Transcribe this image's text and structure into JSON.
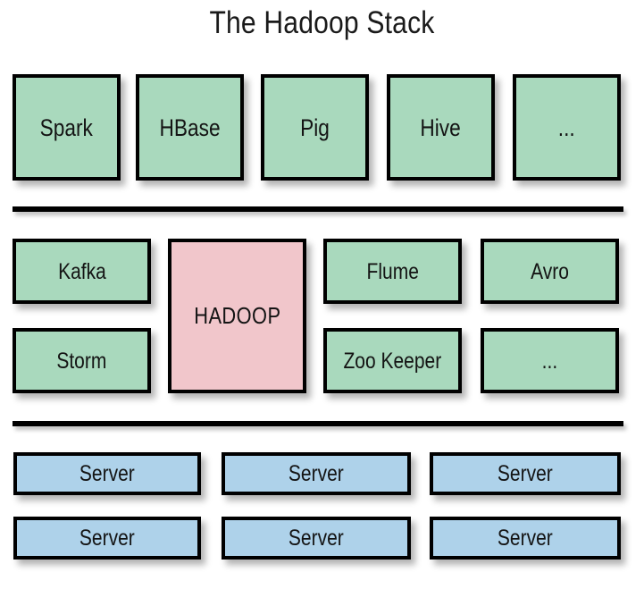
{
  "diagram": {
    "title": "The Hadoop Stack",
    "background_color": "#ffffff",
    "colors": {
      "tool_fill": "#a9d9bd",
      "core_fill": "#f1c6cb",
      "server_fill": "#aed2ea",
      "border": "#000000",
      "text": "#141414"
    },
    "layers": {
      "applications": {
        "boxes": [
          {
            "label": "Spark"
          },
          {
            "label": "HBase"
          },
          {
            "label": "Pig"
          },
          {
            "label": "Hive"
          },
          {
            "label": "..."
          }
        ]
      },
      "platform": {
        "core": {
          "label": "HADOOP"
        },
        "left_column": [
          {
            "label": "Kafka"
          },
          {
            "label": "Storm"
          }
        ],
        "middle_column": [
          {
            "label": "Flume"
          },
          {
            "label": "Zoo Keeper"
          }
        ],
        "right_column": [
          {
            "label": "Avro"
          },
          {
            "label": "..."
          }
        ]
      },
      "infrastructure": {
        "rows": [
          [
            {
              "label": "Server"
            },
            {
              "label": "Server"
            },
            {
              "label": "Server"
            }
          ],
          [
            {
              "label": "Server"
            },
            {
              "label": "Server"
            },
            {
              "label": "Server"
            }
          ]
        ]
      }
    }
  }
}
